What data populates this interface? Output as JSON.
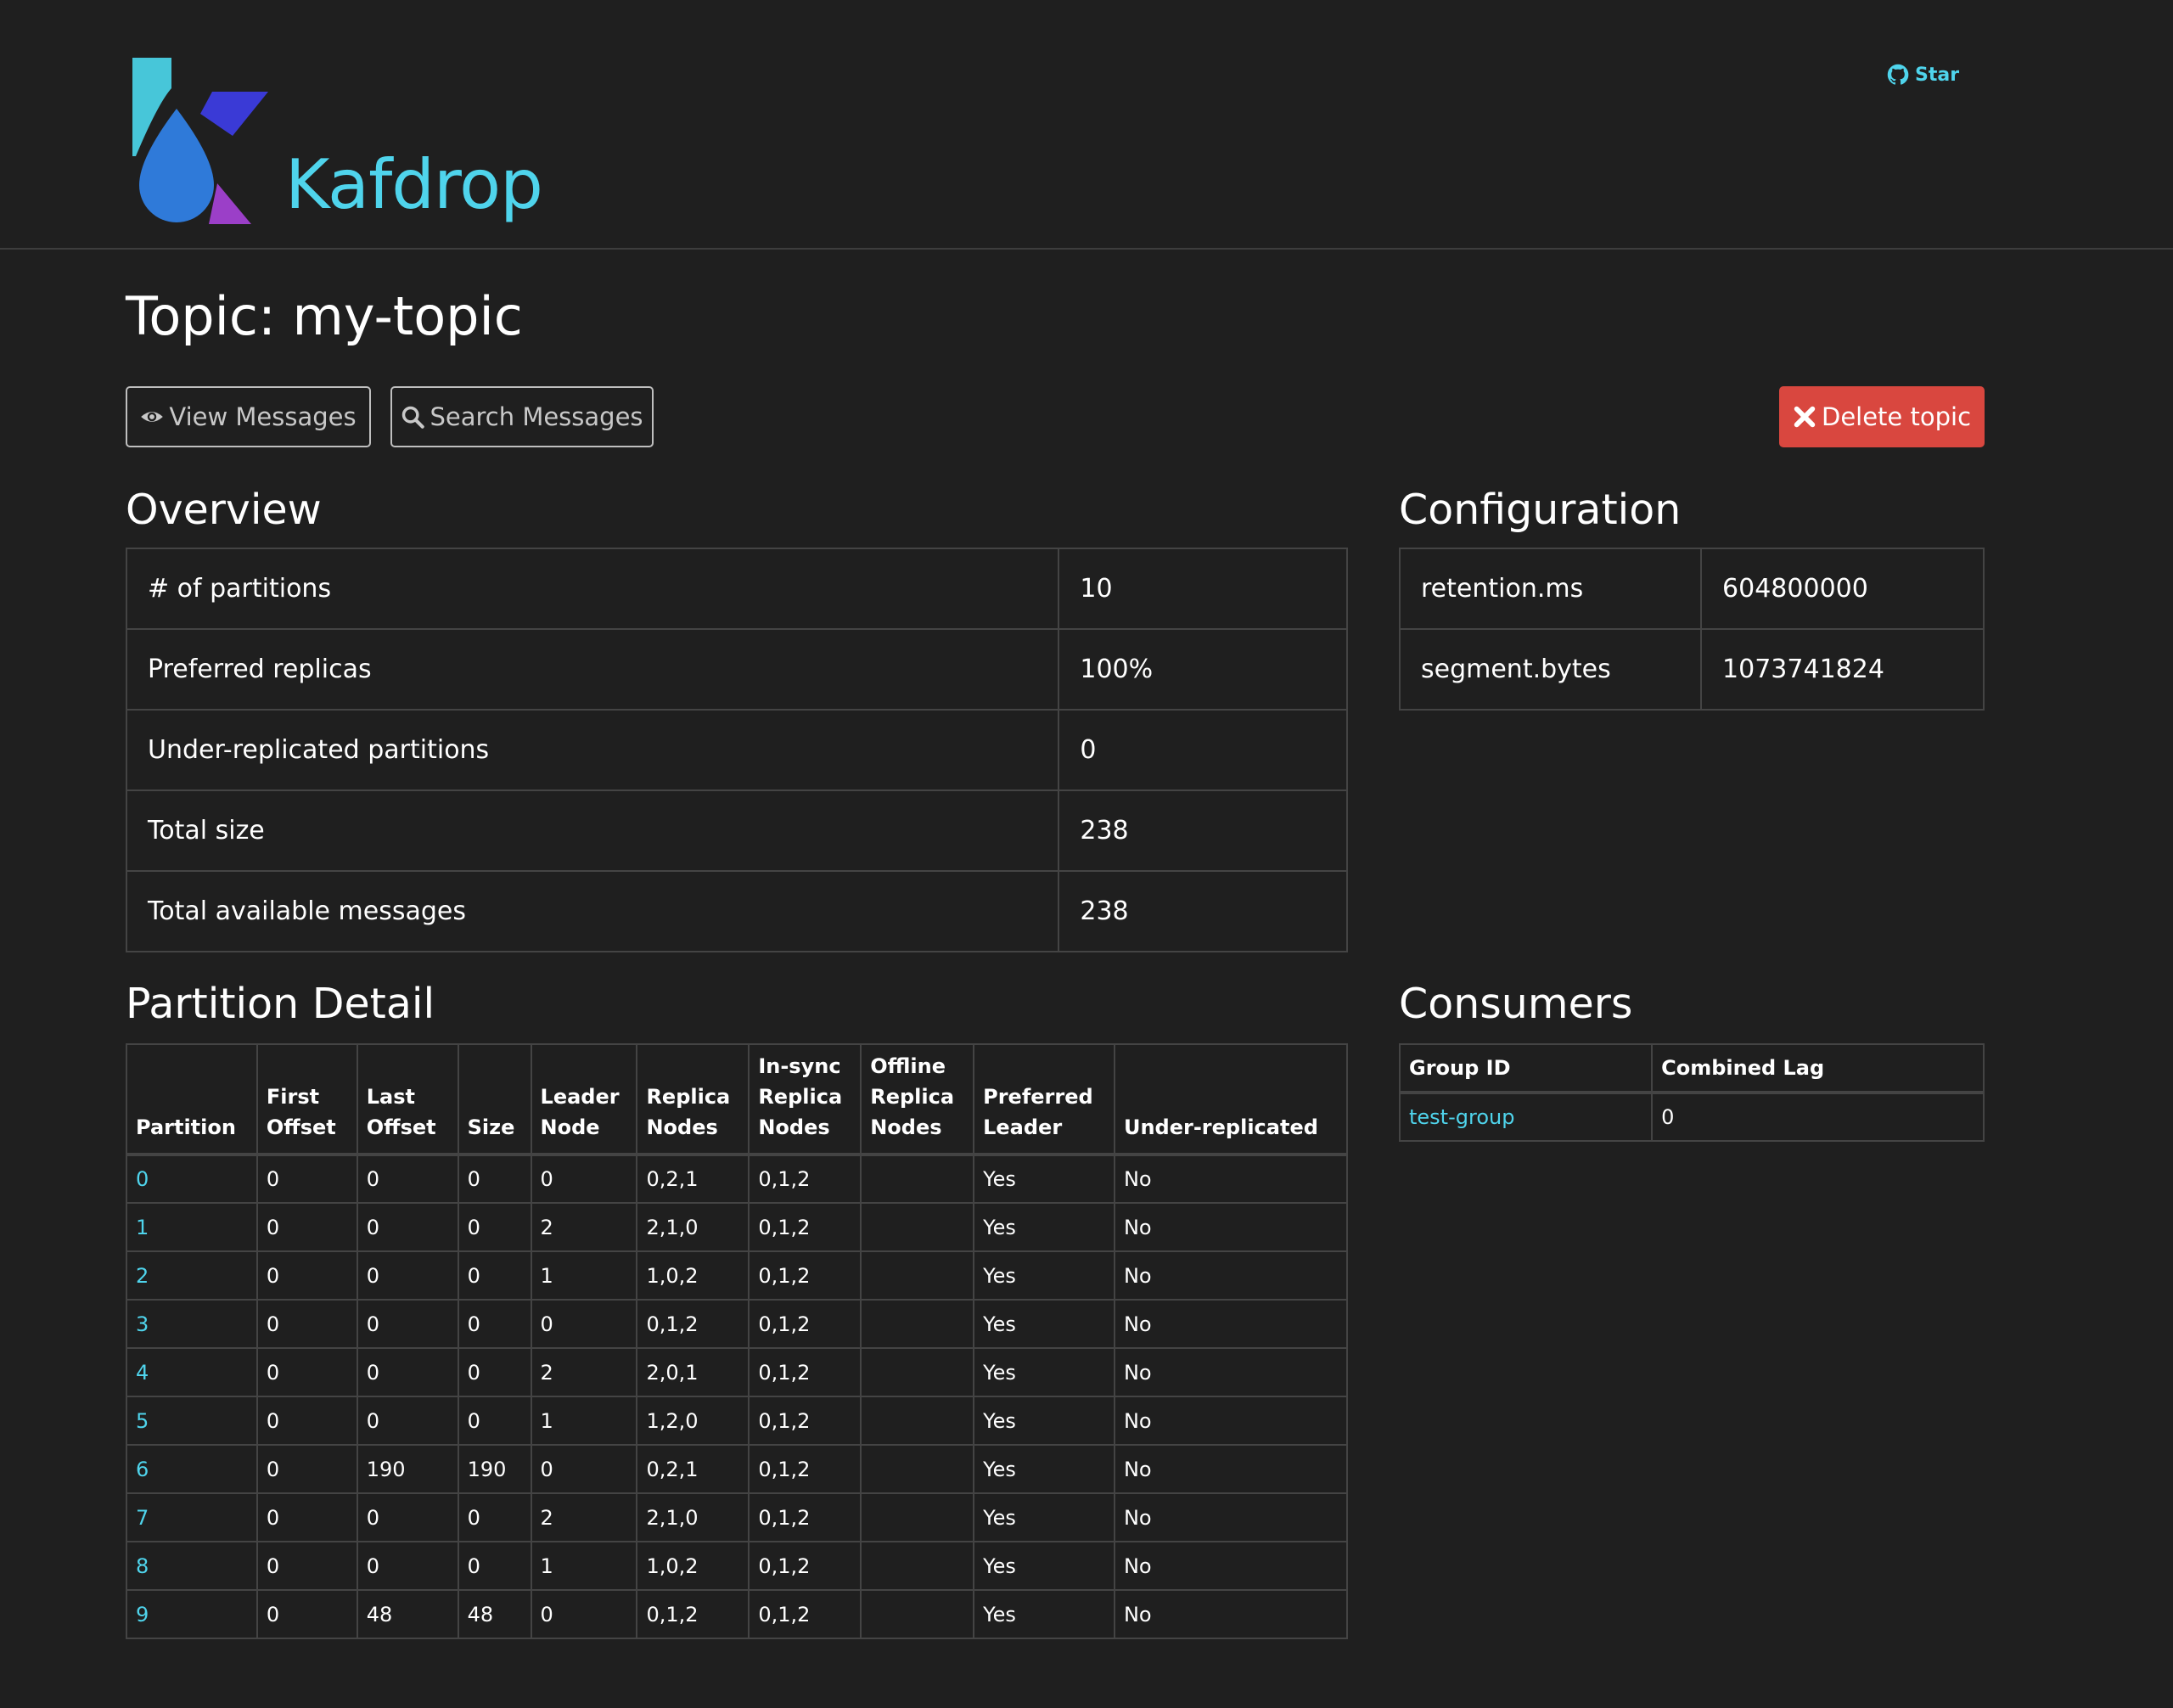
{
  "header": {
    "brand": "Kafdrop",
    "star_label": "Star",
    "icons": {
      "logo": "kafdrop-logo",
      "star": "github-icon"
    }
  },
  "page": {
    "title": "Topic: my-topic"
  },
  "actions": {
    "view_messages": "View Messages",
    "search_messages": "Search Messages",
    "delete_topic": "Delete topic",
    "icons": {
      "view": "eye-icon",
      "search": "search-icon",
      "delete": "close-icon"
    }
  },
  "overview": {
    "title": "Overview",
    "rows": [
      {
        "label": "# of partitions",
        "value": "10"
      },
      {
        "label": "Preferred replicas",
        "value": "100%"
      },
      {
        "label": "Under-replicated partitions",
        "value": "0"
      },
      {
        "label": "Total size",
        "value": "238"
      },
      {
        "label": "Total available messages",
        "value": "238"
      }
    ]
  },
  "configuration": {
    "title": "Configuration",
    "rows": [
      {
        "key": "retention.ms",
        "value": "604800000"
      },
      {
        "key": "segment.bytes",
        "value": "1073741824"
      }
    ]
  },
  "partition_detail": {
    "title": "Partition Detail",
    "columns": [
      [
        "Partition"
      ],
      [
        "First",
        "Offset"
      ],
      [
        "Last",
        "Offset"
      ],
      [
        "Size"
      ],
      [
        "Leader",
        "Node"
      ],
      [
        "Replica",
        "Nodes"
      ],
      [
        "In-sync",
        "Replica",
        "Nodes"
      ],
      [
        "Offline",
        "Replica",
        "Nodes"
      ],
      [
        "Preferred",
        "Leader"
      ],
      [
        "Under-replicated"
      ]
    ],
    "rows": [
      [
        "0",
        "0",
        "0",
        "0",
        "0",
        "0,2,1",
        "0,1,2",
        "",
        "Yes",
        "No"
      ],
      [
        "1",
        "0",
        "0",
        "0",
        "2",
        "2,1,0",
        "0,1,2",
        "",
        "Yes",
        "No"
      ],
      [
        "2",
        "0",
        "0",
        "0",
        "1",
        "1,0,2",
        "0,1,2",
        "",
        "Yes",
        "No"
      ],
      [
        "3",
        "0",
        "0",
        "0",
        "0",
        "0,1,2",
        "0,1,2",
        "",
        "Yes",
        "No"
      ],
      [
        "4",
        "0",
        "0",
        "0",
        "2",
        "2,0,1",
        "0,1,2",
        "",
        "Yes",
        "No"
      ],
      [
        "5",
        "0",
        "0",
        "0",
        "1",
        "1,2,0",
        "0,1,2",
        "",
        "Yes",
        "No"
      ],
      [
        "6",
        "0",
        "190",
        "190",
        "0",
        "0,2,1",
        "0,1,2",
        "",
        "Yes",
        "No"
      ],
      [
        "7",
        "0",
        "0",
        "0",
        "2",
        "2,1,0",
        "0,1,2",
        "",
        "Yes",
        "No"
      ],
      [
        "8",
        "0",
        "0",
        "0",
        "1",
        "1,0,2",
        "0,1,2",
        "",
        "Yes",
        "No"
      ],
      [
        "9",
        "0",
        "48",
        "48",
        "0",
        "0,1,2",
        "0,1,2",
        "",
        "Yes",
        "No"
      ]
    ]
  },
  "consumers": {
    "title": "Consumers",
    "columns": [
      "Group ID",
      "Combined Lag"
    ],
    "rows": [
      {
        "group_id": "test-group",
        "lag": "0"
      }
    ]
  },
  "colors": {
    "background": "#1f1f1f",
    "accent": "#4fd4ec",
    "danger": "#d9473f",
    "border": "#444444"
  }
}
